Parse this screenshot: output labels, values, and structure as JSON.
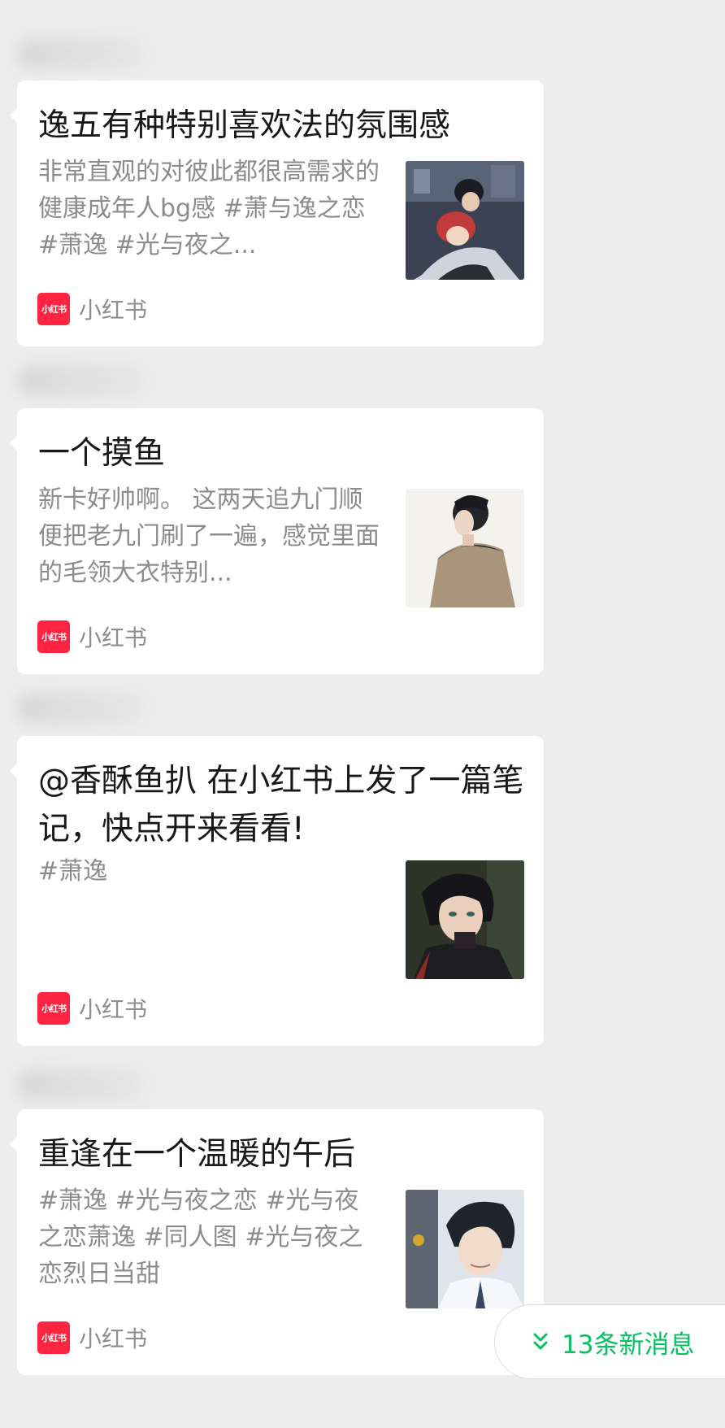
{
  "messages": [
    {
      "title": "逸五有种特别喜欢法的氛围感",
      "desc": "非常直观的对彼此都很高需求的健康成年人bg感 #萧与逸之恋 #萧逸 #光与夜之...",
      "source": "小红书",
      "thumb_icon": "anime-couple-thumbnail"
    },
    {
      "title": "一个摸鱼",
      "desc": "新卡好帅啊。 这两天追九门顺便把老九门刷了一遍，感觉里面的毛领大衣特别...",
      "source": "小红书",
      "thumb_icon": "anime-coat-thumbnail"
    },
    {
      "title": "@香酥鱼扒 在小红书上发了一篇笔记，快点开来看看!",
      "desc": "#萧逸",
      "source": "小红书",
      "thumb_icon": "anime-portrait-thumbnail"
    },
    {
      "title": "重逢在一个温暖的午后",
      "desc": "#萧逸 #光与夜之恋 #光与夜之恋萧逸 #同人图 #光与夜之恋烈日当甜",
      "source": "小红书",
      "thumb_icon": "anime-smile-thumbnail"
    }
  ],
  "logo_text": "小红书",
  "new_messages_label": "13条新消息",
  "colors": {
    "background": "#ededed",
    "card": "#ffffff",
    "brand_red": "#ff2442",
    "wechat_green": "#07c160"
  }
}
